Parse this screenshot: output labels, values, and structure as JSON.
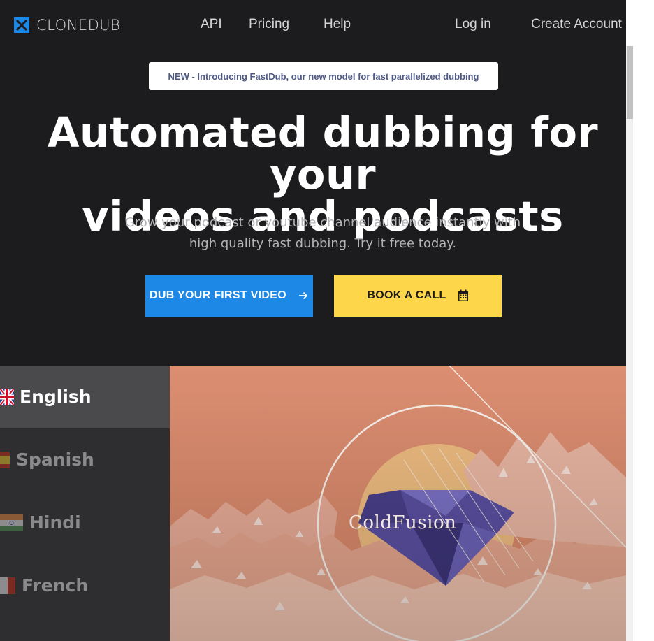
{
  "brand": {
    "name": "CLONEDUB",
    "accent": "#1d88e5"
  },
  "nav": {
    "links": [
      "API",
      "Pricing",
      "Help"
    ],
    "login": "Log in",
    "create_account": "Create Account"
  },
  "announcement": "NEW - Introducing FastDub, our new model for fast parallelized dubbing",
  "hero": {
    "headline_line1": "Automated dubbing for your",
    "headline_line2": "videos and podcasts",
    "sub_line1": "Grow your podcast or youtube channel audience instantly with",
    "sub_line2": "high quality fast dubbing. Try it free today."
  },
  "cta": {
    "primary_label": "DUB YOUR FIRST VIDEO",
    "primary_icon": "arrow-right-icon",
    "primary_color": "#1d88e5",
    "secondary_label": "BOOK A CALL",
    "secondary_icon": "calendar-icon",
    "secondary_color": "#fdd649"
  },
  "languages": {
    "selected": "English",
    "items": [
      {
        "label": "English",
        "flag": "uk-flag-icon"
      },
      {
        "label": "Spanish",
        "flag": "spain-flag-icon"
      },
      {
        "label": "Hindi",
        "flag": "india-flag-icon"
      },
      {
        "label": "French",
        "flag": "france-flag-icon"
      }
    ]
  },
  "video": {
    "title_text": "ColdFusion"
  }
}
